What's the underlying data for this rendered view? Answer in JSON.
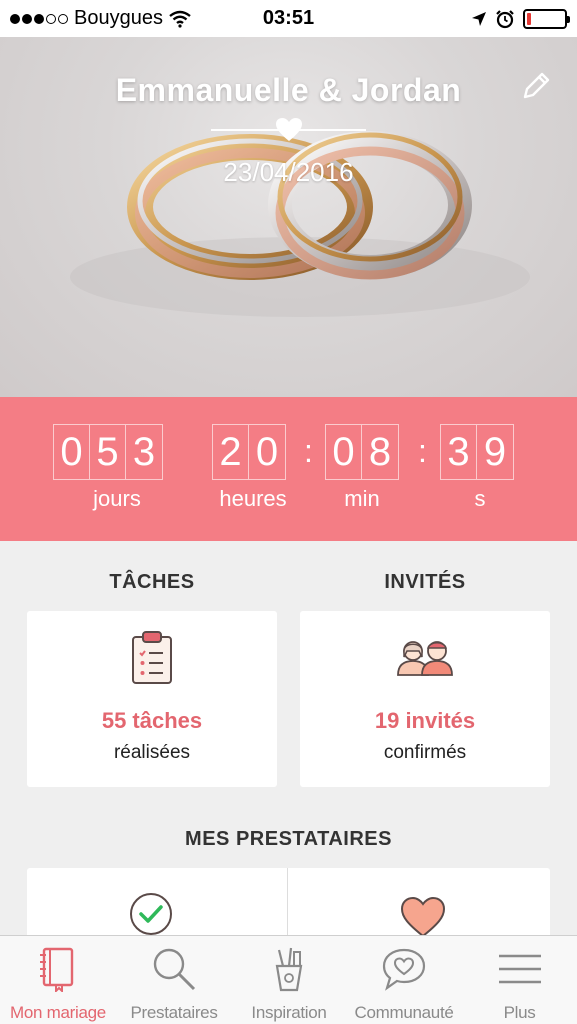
{
  "status_bar": {
    "carrier": "Bouygues",
    "time": "03:51",
    "signal_bars": 3,
    "signal_total": 5,
    "battery_level": 0.12,
    "icons": [
      "wifi-icon",
      "location-arrow-icon",
      "alarm-icon",
      "battery-icon"
    ]
  },
  "hero": {
    "couple": "Emmanuelle & Jordan",
    "date": "23/04/2016",
    "icons": [
      "edit-pencil-icon",
      "heart-icon"
    ]
  },
  "countdown": {
    "days_digits": [
      "0",
      "5",
      "3"
    ],
    "hours_digits": [
      "2",
      "0"
    ],
    "minutes_digits": [
      "0",
      "8"
    ],
    "seconds_digits": [
      "3",
      "9"
    ],
    "days_label": "jours",
    "hours_label": "heures",
    "minutes_label": "min",
    "seconds_label": "s",
    "separator": ":"
  },
  "tasks": {
    "title": "TÂCHES",
    "value": "55 tâches",
    "sub": "réalisées",
    "icon": "clipboard-checklist-icon"
  },
  "guests": {
    "title": "INVITÉS",
    "value": "19 invités",
    "sub": "confirmés",
    "icon": "couple-guests-icon"
  },
  "providers": {
    "title": "MES PRESTATAIRES",
    "icons": [
      "check-circle-icon",
      "heart-icon"
    ]
  },
  "tabbar": {
    "tabs": [
      {
        "label": "Mon mariage",
        "icon": "notebook-icon",
        "active": true
      },
      {
        "label": "Prestataires",
        "icon": "search-icon",
        "active": false
      },
      {
        "label": "Inspiration",
        "icon": "pencil-cup-icon",
        "active": false
      },
      {
        "label": "Communauté",
        "icon": "chat-heart-icon",
        "active": false
      },
      {
        "label": "Plus",
        "icon": "menu-icon",
        "active": false
      }
    ]
  },
  "colors": {
    "accent": "#f47d85",
    "accent_text": "#e3666f",
    "background": "#efefef"
  }
}
